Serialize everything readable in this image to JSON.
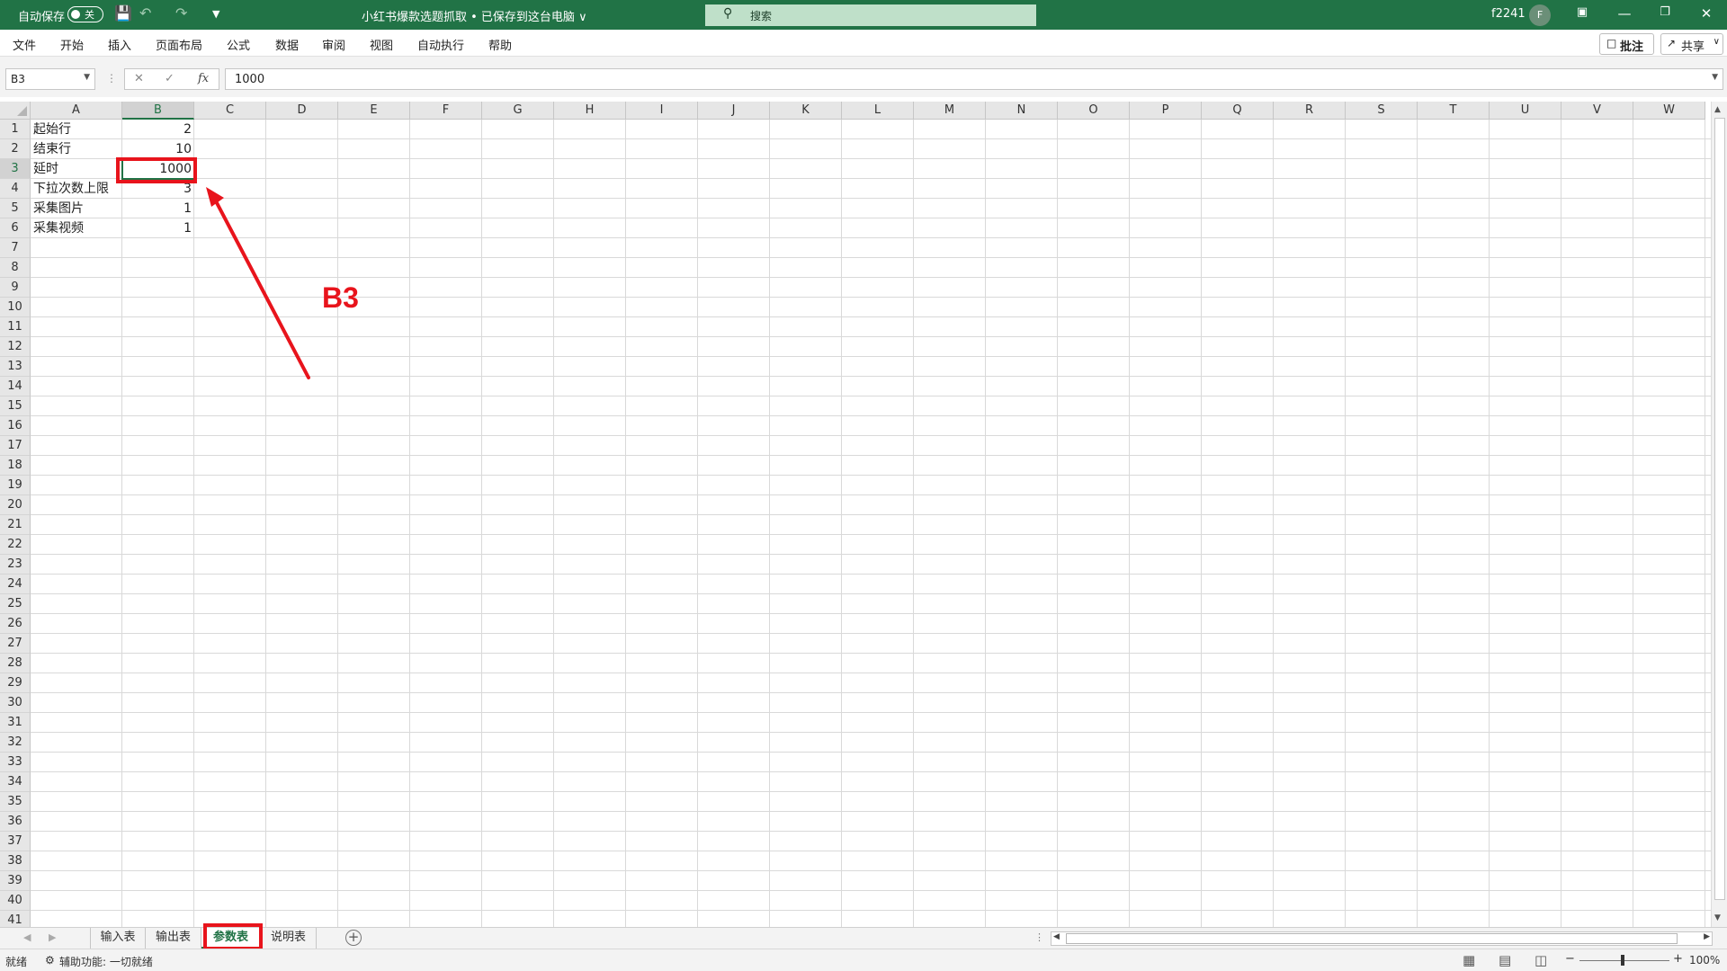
{
  "titlebar": {
    "autosave_label": "自动保存",
    "autosave_state": "关",
    "doc_title": "小红书爆款选题抓取 • 已保存到这台电脑 ∨",
    "search_placeholder": "搜索",
    "user": "f2241",
    "avatar_letter": "F"
  },
  "menubar": {
    "items": [
      "文件",
      "开始",
      "插入",
      "页面布局",
      "公式",
      "数据",
      "审阅",
      "视图",
      "自动执行",
      "帮助"
    ],
    "comments_label": "批注",
    "share_label": "共享"
  },
  "formulabar": {
    "name_box": "B3",
    "formula": "1000"
  },
  "grid": {
    "columns": [
      "A",
      "B",
      "C",
      "D",
      "E",
      "F",
      "G",
      "H",
      "I",
      "J",
      "K",
      "L",
      "M",
      "N",
      "O",
      "P",
      "Q",
      "R",
      "S",
      "T",
      "U",
      "V",
      "W"
    ],
    "selected_column": "B",
    "selected_row": 3,
    "row_count": 41,
    "rows": [
      {
        "a": "起始行",
        "b": "2"
      },
      {
        "a": "结束行",
        "b": "10"
      },
      {
        "a": "延时",
        "b": "1000"
      },
      {
        "a": "下拉次数上限",
        "b": "3"
      },
      {
        "a": "采集图片",
        "b": "1"
      },
      {
        "a": "采集视频",
        "b": "1"
      }
    ]
  },
  "annotation": {
    "label": "B3",
    "color": "#e8141c"
  },
  "sheets": {
    "tabs": [
      "输入表",
      "输出表",
      "参数表",
      "说明表"
    ],
    "active": "参数表"
  },
  "statusbar": {
    "ready": "就绪",
    "accessibility": "辅助功能: 一切就绪",
    "zoom": "100%"
  },
  "colors": {
    "excel_green": "#217346",
    "annotation_red": "#e8141c"
  }
}
